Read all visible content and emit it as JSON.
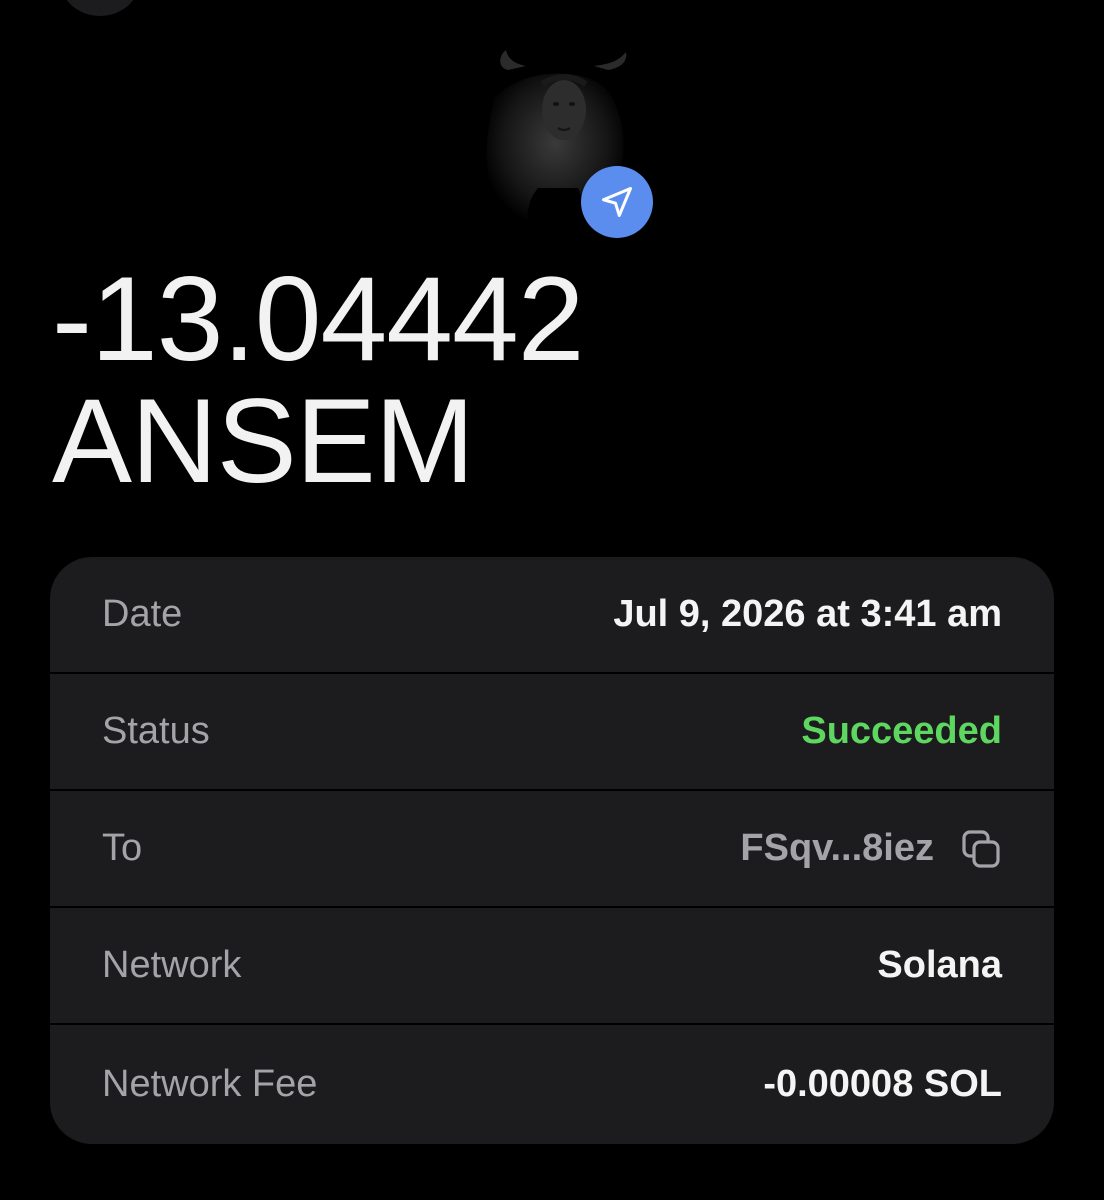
{
  "header": {
    "back_icon": "back-button-circle"
  },
  "token": {
    "image_icon": "bull-token-avatar",
    "badge_icon": "send-arrow-icon",
    "badge_color": "#5b8def"
  },
  "amount": {
    "value": "-13.04442",
    "symbol": "ANSEM"
  },
  "details": {
    "date_label": "Date",
    "date_value": "Jul 9, 2026 at 3:41 am",
    "status_label": "Status",
    "status_value": "Succeeded",
    "status_color": "#5ed760",
    "to_label": "To",
    "to_value": "FSqv...8iez",
    "copy_icon": "copy-icon",
    "network_label": "Network",
    "network_value": "Solana",
    "fee_label": "Network Fee",
    "fee_value": "-0.00008 SOL"
  }
}
